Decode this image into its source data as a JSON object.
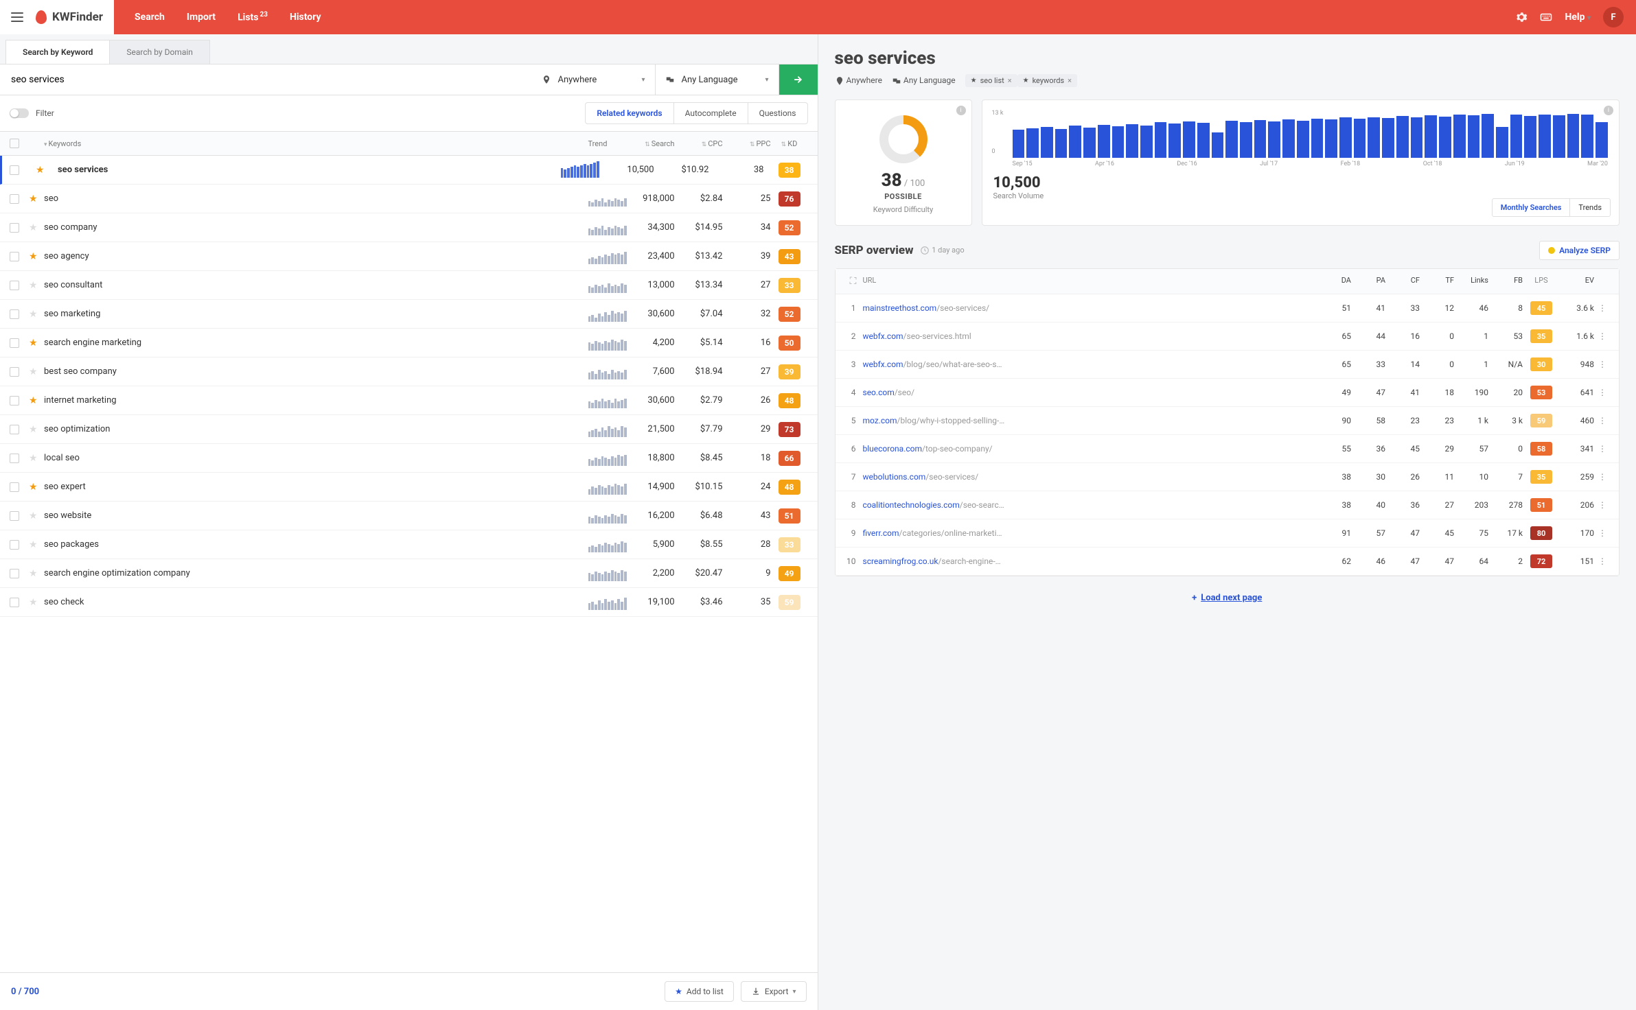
{
  "app": {
    "name": "KWFinder"
  },
  "nav": {
    "items": [
      "Search",
      "Import",
      "Lists",
      "History"
    ],
    "lists_badge": "23",
    "help": "Help",
    "avatar": "F"
  },
  "tabs": {
    "a": "Search by Keyword",
    "b": "Search by Domain"
  },
  "search": {
    "kw": "seo services",
    "location": "Anywhere",
    "language": "Any Language"
  },
  "filter": {
    "label": "Filter"
  },
  "suggest": {
    "a": "Related keywords",
    "b": "Autocomplete",
    "c": "Questions"
  },
  "cols": {
    "kw": "Keywords",
    "trend": "Trend",
    "search": "Search",
    "cpc": "CPC",
    "ppc": "PPC",
    "kd": "KD"
  },
  "kd_colors": {
    "38": "#fdb515",
    "76": "#c0392b",
    "52": "#eb6a2e",
    "43": "#f39c12",
    "33": "#f9b934",
    "50": "#eb6a2e",
    "39": "#f9b934",
    "48": "#f4a213",
    "73": "#c0392b",
    "66": "#e05a2b",
    "51": "#eb6a2e",
    "49": "#f4a213",
    "59": "#f8c977",
    "30": "#f9b934",
    "53": "#eb6a2e",
    "58": "#eb6a2e",
    "35": "#f9b934",
    "45": "#f9b934",
    "72": "#c0392b",
    "80": "#a93226"
  },
  "rows": [
    {
      "star": true,
      "kw": "seo services",
      "search": "10,500",
      "cpc": "$10.92",
      "ppc": "38",
      "kd": "38",
      "sel": true,
      "trend": [
        7,
        6,
        7,
        8,
        9,
        8,
        9,
        10,
        9,
        10,
        11,
        12
      ]
    },
    {
      "star": true,
      "kw": "seo",
      "search": "918,000",
      "cpc": "$2.84",
      "ppc": "25",
      "kd": "76",
      "trend": [
        4,
        3,
        5,
        4,
        6,
        3,
        5,
        4,
        6,
        5,
        4,
        6
      ]
    },
    {
      "star": false,
      "kw": "seo company",
      "search": "34,300",
      "cpc": "$14.95",
      "ppc": "34",
      "kd": "52",
      "trend": [
        5,
        4,
        6,
        5,
        7,
        4,
        6,
        5,
        7,
        6,
        5,
        7
      ]
    },
    {
      "star": true,
      "kw": "seo agency",
      "search": "23,400",
      "cpc": "$13.42",
      "ppc": "39",
      "kd": "43",
      "trend": [
        4,
        5,
        4,
        6,
        5,
        7,
        6,
        8,
        7,
        8,
        7,
        9
      ]
    },
    {
      "star": false,
      "kw": "seo consultant",
      "search": "13,000",
      "cpc": "$13.34",
      "ppc": "27",
      "kd": "33",
      "trend": [
        5,
        4,
        6,
        5,
        6,
        4,
        7,
        5,
        6,
        5,
        7,
        6
      ]
    },
    {
      "star": false,
      "kw": "seo marketing",
      "search": "30,600",
      "cpc": "$7.04",
      "ppc": "32",
      "kd": "52",
      "trend": [
        4,
        5,
        3,
        6,
        4,
        7,
        5,
        8,
        6,
        7,
        6,
        8
      ]
    },
    {
      "star": true,
      "kw": "search engine marketing",
      "search": "4,200",
      "cpc": "$5.14",
      "ppc": "16",
      "kd": "50",
      "trend": [
        6,
        5,
        7,
        6,
        5,
        7,
        6,
        8,
        7,
        6,
        8,
        7
      ]
    },
    {
      "star": false,
      "kw": "best seo company",
      "search": "7,600",
      "cpc": "$18.94",
      "ppc": "27",
      "kd": "39",
      "trend": [
        5,
        6,
        4,
        7,
        5,
        6,
        4,
        7,
        5,
        6,
        5,
        7
      ]
    },
    {
      "star": true,
      "kw": "internet marketing",
      "search": "30,600",
      "cpc": "$2.79",
      "ppc": "26",
      "kd": "48",
      "trend": [
        5,
        4,
        6,
        5,
        7,
        5,
        6,
        4,
        7,
        5,
        6,
        7
      ]
    },
    {
      "star": false,
      "kw": "seo optimization",
      "search": "21,500",
      "cpc": "$7.79",
      "ppc": "29",
      "kd": "73",
      "trend": [
        4,
        5,
        6,
        4,
        7,
        5,
        8,
        6,
        7,
        5,
        8,
        7
      ]
    },
    {
      "star": false,
      "kw": "local seo",
      "search": "18,800",
      "cpc": "$8.45",
      "ppc": "18",
      "kd": "66",
      "trend": [
        5,
        4,
        6,
        5,
        7,
        6,
        5,
        7,
        6,
        8,
        7,
        8
      ]
    },
    {
      "star": true,
      "kw": "seo expert",
      "search": "14,900",
      "cpc": "$10.15",
      "ppc": "24",
      "kd": "48",
      "trend": [
        4,
        6,
        5,
        7,
        6,
        5,
        7,
        6,
        8,
        7,
        6,
        8
      ]
    },
    {
      "star": false,
      "kw": "seo website",
      "search": "16,200",
      "cpc": "$6.48",
      "ppc": "43",
      "kd": "51",
      "trend": [
        5,
        4,
        6,
        5,
        4,
        6,
        5,
        7,
        6,
        5,
        7,
        6
      ]
    },
    {
      "star": false,
      "kw": "seo packages",
      "search": "5,900",
      "cpc": "$8.55",
      "ppc": "28",
      "kd": "33",
      "faded": true,
      "trend": [
        4,
        5,
        4,
        6,
        5,
        7,
        6,
        5,
        7,
        6,
        8,
        7
      ]
    },
    {
      "star": false,
      "kw": "search engine optimization company",
      "search": "2,200",
      "cpc": "$20.47",
      "ppc": "9",
      "kd": "49",
      "trend": [
        6,
        5,
        7,
        6,
        5,
        7,
        6,
        8,
        7,
        6,
        8,
        7
      ]
    },
    {
      "star": false,
      "kw": "seo check",
      "search": "19,100",
      "cpc": "$3.46",
      "ppc": "35",
      "kd": "59",
      "faded": true,
      "trend": [
        5,
        6,
        4,
        7,
        5,
        8,
        6,
        7,
        5,
        8,
        6,
        9
      ]
    }
  ],
  "footer": {
    "count": "0 / 700",
    "add": "Add to list",
    "export": "Export"
  },
  "detail": {
    "title": "seo services",
    "location": "Anywhere",
    "language": "Any Language",
    "chips": [
      {
        "t": "seo list"
      },
      {
        "t": "keywords"
      }
    ],
    "kd": {
      "val": "38",
      "max": "/ 100",
      "label": "POSSIBLE",
      "sub": "Keyword Difficulty"
    },
    "vol": {
      "ymax": "13 k",
      "ymin": "0",
      "val": "10,500",
      "label": "Search Volume",
      "xlabels": [
        "Sep '15",
        "Apr '16",
        "Dec '16",
        "Jul '17",
        "Feb '18",
        "Oct '18",
        "Jun '19",
        "Mar '20"
      ],
      "tabs": {
        "a": "Monthly Searches",
        "b": "Trends"
      }
    }
  },
  "chart_data": {
    "type": "bar",
    "title": "Search Volume",
    "ylabel": "Monthly searches",
    "ylim": [
      0,
      13000
    ],
    "x_range": [
      "Sep '15",
      "Mar '20"
    ],
    "x_ticks": [
      "Sep '15",
      "Apr '16",
      "Dec '16",
      "Jul '17",
      "Feb '18",
      "Oct '18",
      "Jun '19",
      "Mar '20"
    ],
    "values": [
      8400,
      8800,
      9200,
      8600,
      9500,
      9000,
      9800,
      9400,
      10000,
      9600,
      10500,
      10200,
      10800,
      10400,
      7600,
      11000,
      10600,
      11200,
      10800,
      11400,
      11000,
      11600,
      11300,
      11900,
      11500,
      12000,
      11700,
      12300,
      12000,
      12600,
      12200,
      12800,
      12500,
      13000,
      9200,
      12700,
      12400,
      12900,
      12600,
      13000,
      12800,
      10500
    ]
  },
  "serp": {
    "title": "SERP overview",
    "time": "1 day ago",
    "analyze": "Analyze SERP",
    "load": "Load next page",
    "cols": {
      "url": "URL",
      "da": "DA",
      "pa": "PA",
      "cf": "CF",
      "tf": "TF",
      "links": "Links",
      "fb": "FB",
      "lps": "LPS",
      "ev": "EV"
    },
    "rows": [
      {
        "i": "1",
        "dom": "mainstreethost.com",
        "path": "/seo-services/",
        "da": "51",
        "pa": "41",
        "cf": "33",
        "tf": "12",
        "links": "46",
        "fb": "8",
        "lps": "45",
        "ev": "3.6 k"
      },
      {
        "i": "2",
        "dom": "webfx.com",
        "path": "/seo-services.html",
        "da": "65",
        "pa": "44",
        "cf": "16",
        "tf": "0",
        "links": "1",
        "fb": "53",
        "lps": "35",
        "ev": "1.6 k"
      },
      {
        "i": "3",
        "dom": "webfx.com",
        "path": "/blog/seo/what-are-seo-s…",
        "da": "65",
        "pa": "33",
        "cf": "14",
        "tf": "0",
        "links": "1",
        "fb": "N/A",
        "lps": "30",
        "ev": "948"
      },
      {
        "i": "4",
        "dom": "seo.com",
        "path": "/seo/",
        "da": "49",
        "pa": "47",
        "cf": "41",
        "tf": "18",
        "links": "190",
        "fb": "20",
        "lps": "53",
        "ev": "641"
      },
      {
        "i": "5",
        "dom": "moz.com",
        "path": "/blog/why-i-stopped-selling-…",
        "da": "90",
        "pa": "58",
        "cf": "23",
        "tf": "23",
        "links": "1 k",
        "fb": "3 k",
        "lps": "59",
        "ev": "460"
      },
      {
        "i": "6",
        "dom": "bluecorona.com",
        "path": "/top-seo-company/",
        "da": "55",
        "pa": "36",
        "cf": "45",
        "tf": "29",
        "links": "57",
        "fb": "0",
        "lps": "58",
        "ev": "341"
      },
      {
        "i": "7",
        "dom": "webolutions.com",
        "path": "/seo-services/",
        "da": "38",
        "pa": "30",
        "cf": "26",
        "tf": "11",
        "links": "10",
        "fb": "7",
        "lps": "35",
        "ev": "259"
      },
      {
        "i": "8",
        "dom": "coalitiontechnologies.com",
        "path": "/seo-searc…",
        "da": "38",
        "pa": "40",
        "cf": "36",
        "tf": "27",
        "links": "203",
        "fb": "278",
        "lps": "51",
        "ev": "206"
      },
      {
        "i": "9",
        "dom": "fiverr.com",
        "path": "/categories/online-marketi…",
        "da": "91",
        "pa": "57",
        "cf": "47",
        "tf": "45",
        "links": "75",
        "fb": "17 k",
        "lps": "80",
        "ev": "170"
      },
      {
        "i": "10",
        "dom": "screamingfrog.co.uk",
        "path": "/search-engine-…",
        "da": "62",
        "pa": "46",
        "cf": "47",
        "tf": "47",
        "links": "64",
        "fb": "2",
        "lps": "72",
        "ev": "151"
      }
    ]
  }
}
